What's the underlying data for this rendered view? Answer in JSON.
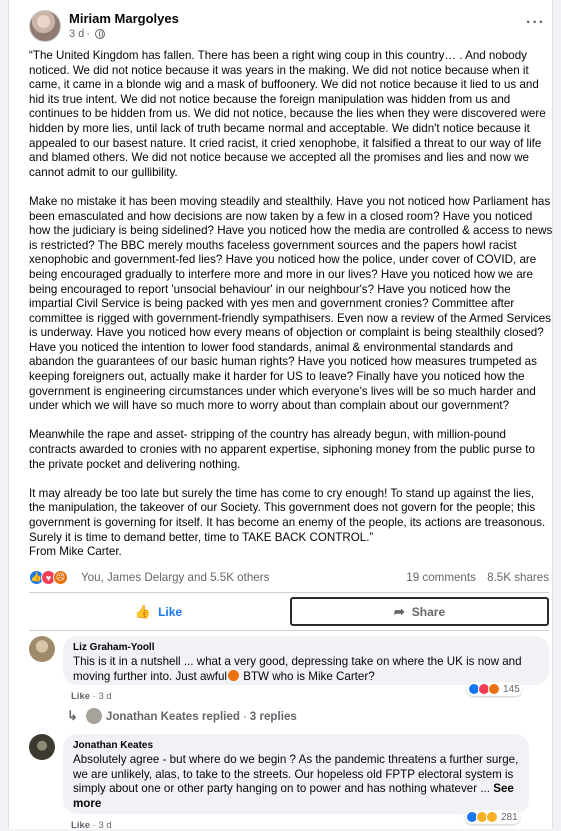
{
  "post": {
    "author": "Miriam Margolyes",
    "time": "3 d",
    "more_label": "···",
    "paragraphs": [
      "“The United Kingdom has fallen. There has been a right wing coup in this country… . And nobody noticed. We did not notice because it was years in the making. We did not notice because when it came, it came in a blonde wig and a mask of buffoonery. We did not notice because it lied to us and hid its true intent. We did not notice because the foreign manipulation was hidden from us and continues to be hidden from us. We did not notice, because the lies when they were discovered were hidden by more lies, until lack of truth became normal and acceptable. We didn't notice because it appealed to our basest nature. It cried racist, it cried xenophobe, it falsified a threat to our way of life and blamed others. We did not notice because we accepted all the promises and lies and now we cannot admit to our gullibility.",
      "Make no mistake it has been moving steadily and stealthily. Have you not noticed how Parliament has been emasculated and how decisions are now taken by a few in a closed room? Have you noticed how the judiciary is being sidelined? Have you noticed how the media are controlled & access to news is restricted? The BBC merely mouths faceless government sources and the papers howl racist xenophobic and government-fed lies? Have you noticed how the police, under cover of COVID, are being encouraged gradually to interfere more and more in our lives? Have you noticed how we are being encouraged to report 'unsocial behaviour' in our neighbour's? Have you noticed how  the impartial Civil Service is being packed with yes men and government cronies? Committee after committee is rigged with government-friendly sympathisers. Even now a review of the Armed Services is underway. Have you noticed how every means of objection or complaint is being stealthily closed? Have you noticed the intention to lower food standards, animal & environmental standards and abandon the guarantees of our basic human rights? Have you noticed how measures trumpeted as keeping foreigners out, actually make it harder for US to leave? Finally have you noticed how the government is engineering circumstances under which everyone's lives will be so much harder and under which we will have so much more to worry about than complain about our government?",
      "Meanwhile the rape and asset- stripping of the country has already begun, with million-pound contracts awarded to cronies with no apparent expertise, siphoning money from the public purse to the private pocket and delivering nothing.",
      "It may already be too late but surely the time has come to cry enough! To stand up against the lies, the manipulation, the takeover of our Society. This government does not govern for the people; this government is governing for itself. It has become an enemy of the people, its actions are treasonous. Surely it is time to demand better, time to TAKE BACK CONTROL.”\nFrom Mike Carter."
    ]
  },
  "stats": {
    "reactors": "You, James Delargy and 5.5K others",
    "comments": "19 comments",
    "shares": "8.5K shares",
    "reaction_icons": [
      "like-icon",
      "love-icon",
      "angry-icon"
    ]
  },
  "actions": {
    "like_label": "Like",
    "share_label": "Share"
  },
  "comments": [
    {
      "name": "Liz Graham-Yooll",
      "text": "This is it in a nutshell ... what a very good, depressing take on where the UK is now and moving further into. Just awful",
      "text_after_emoji": " BTW who is Mike Carter?",
      "reaction_count": "145",
      "like_label": "Like",
      "time": "3 d"
    },
    {
      "name": "Jonathan Keates",
      "text": "Absolutely agree - but where do we begin ? As the pandemic threatens a further surge, we are unlikely, alas, to take to the streets. Our hopeless old FPTP electoral system is simply about one or other party hanging on to power and has nothing whatever ...",
      "see_more": "See more",
      "reaction_count": "281",
      "like_label": "Like",
      "time": "3 d"
    }
  ],
  "replies": {
    "name": "Jonathan Keates replied",
    "separator": "·",
    "count": "3 replies"
  },
  "colors": {
    "accent": "#1877f2",
    "love": "#f33e58",
    "angry": "#e9710f",
    "muted": "#65676b"
  }
}
